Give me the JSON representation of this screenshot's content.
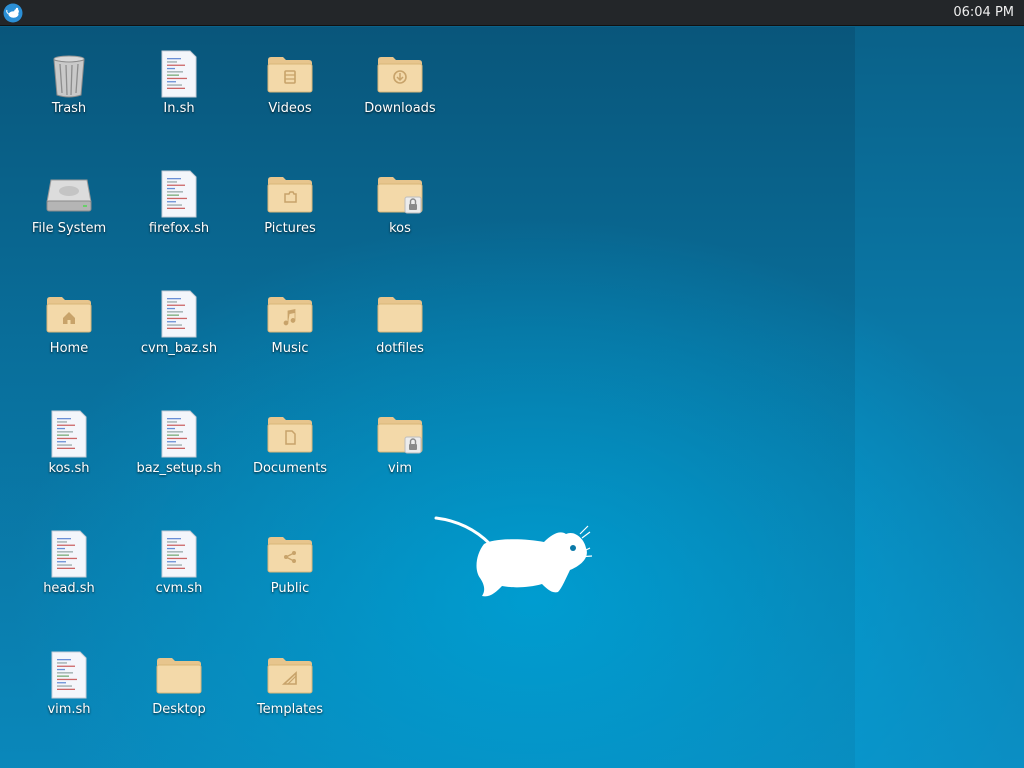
{
  "panel": {
    "menu_icon": "xfce-mouse-icon",
    "clock": "06:04 PM"
  },
  "desktop": {
    "background_colors": [
      "#0a5f86",
      "#0b8fc4",
      "#00a8de"
    ],
    "icons": [
      {
        "label": "Trash",
        "type": "trash",
        "icon": "trash-icon"
      },
      {
        "label": "In.sh",
        "type": "script",
        "icon": "script-file-icon"
      },
      {
        "label": "Videos",
        "type": "folder",
        "emblem": "film",
        "icon": "folder-videos-icon"
      },
      {
        "label": "Downloads",
        "type": "folder",
        "emblem": "download",
        "icon": "folder-downloads-icon"
      },
      {
        "label": "File System",
        "type": "drive",
        "icon": "hard-drive-icon"
      },
      {
        "label": "firefox.sh",
        "type": "script",
        "icon": "script-file-icon"
      },
      {
        "label": "Pictures",
        "type": "folder",
        "emblem": "picture",
        "icon": "folder-pictures-icon"
      },
      {
        "label": "kos",
        "type": "folder",
        "emblem": "lock",
        "icon": "folder-locked-icon"
      },
      {
        "label": "Home",
        "type": "folder",
        "emblem": "home",
        "icon": "folder-home-icon"
      },
      {
        "label": "cvm_baz.sh",
        "type": "script",
        "icon": "script-file-icon"
      },
      {
        "label": "Music",
        "type": "folder",
        "emblem": "music",
        "icon": "folder-music-icon"
      },
      {
        "label": "dotfiles",
        "type": "folder",
        "emblem": "none",
        "icon": "folder-icon"
      },
      {
        "label": "kos.sh",
        "type": "script",
        "icon": "script-file-icon"
      },
      {
        "label": "baz_setup.sh",
        "type": "script",
        "icon": "script-file-icon"
      },
      {
        "label": "Documents",
        "type": "folder",
        "emblem": "document",
        "icon": "folder-documents-icon"
      },
      {
        "label": "vim",
        "type": "folder",
        "emblem": "lock",
        "icon": "folder-locked-icon"
      },
      {
        "label": "head.sh",
        "type": "script",
        "icon": "script-file-icon"
      },
      {
        "label": "cvm.sh",
        "type": "script",
        "icon": "script-file-icon"
      },
      {
        "label": "Public",
        "type": "folder",
        "emblem": "share",
        "icon": "folder-public-icon"
      },
      {
        "label": "vim.sh",
        "type": "script",
        "icon": "script-file-icon"
      },
      {
        "label": "Desktop",
        "type": "folder",
        "emblem": "none",
        "icon": "folder-desktop-icon"
      },
      {
        "label": "Templates",
        "type": "folder",
        "emblem": "template",
        "icon": "folder-templates-icon"
      }
    ],
    "mascot": "xfce-mouse-logo"
  }
}
